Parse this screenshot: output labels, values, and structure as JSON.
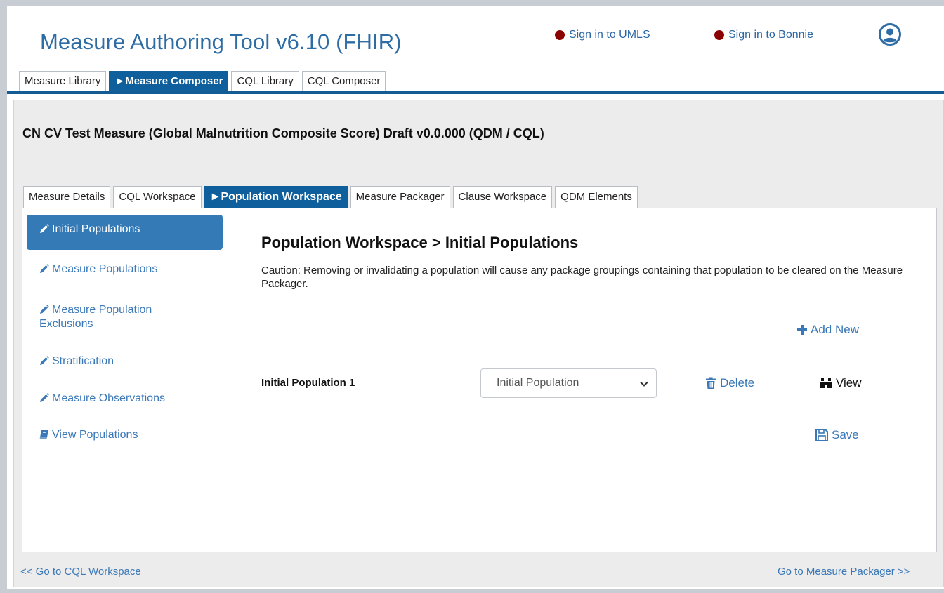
{
  "header": {
    "app_title": "Measure Authoring Tool v6.10 (FHIR)",
    "sign_in_umls": "Sign in to UMLS",
    "sign_in_bonnie": "Sign in to Bonnie",
    "status_color": "#8b0000"
  },
  "main_tabs": [
    {
      "label": "Measure Library",
      "active": false
    },
    {
      "label": "►Measure Composer",
      "active": true
    },
    {
      "label": "CQL Library",
      "active": false
    },
    {
      "label": "CQL Composer",
      "active": false
    }
  ],
  "measure": {
    "title": "CN CV Test Measure (Global Malnutrition Composite Score) Draft v0.0.000 (QDM / CQL)"
  },
  "sub_tabs": [
    {
      "label": "Measure Details",
      "active": false
    },
    {
      "label": "CQL Workspace",
      "active": false
    },
    {
      "label": "►Population Workspace",
      "active": true
    },
    {
      "label": "Measure Packager",
      "active": false
    },
    {
      "label": "Clause Workspace",
      "active": false
    },
    {
      "label": "QDM Elements",
      "active": false
    }
  ],
  "sidebar": {
    "items": [
      {
        "label": "Initial Populations",
        "icon": "pencil-icon",
        "active": true
      },
      {
        "label": "Measure Populations",
        "icon": "pencil-icon",
        "active": false
      },
      {
        "label": "Measure Population Exclusions",
        "icon": "pencil-icon",
        "active": false
      },
      {
        "label": "Stratification",
        "icon": "pencil-icon",
        "active": false
      },
      {
        "label": "Measure Observations",
        "icon": "pencil-icon",
        "active": false
      },
      {
        "label": "View Populations",
        "icon": "book-icon",
        "active": false
      }
    ]
  },
  "main": {
    "heading": "Population Workspace > Initial Populations",
    "caution": "Caution: Removing or invalidating a population will cause any package groupings containing that population to be cleared on the Measure Packager.",
    "add_new": "Add New",
    "population_label": "Initial Population 1",
    "population_select_value": "Initial Population",
    "delete": "Delete",
    "view": "View",
    "save": "Save"
  },
  "footer": {
    "prev": "<< Go to CQL Workspace",
    "next": "Go to Measure Packager >>"
  },
  "colors": {
    "brand_blue": "#2d6ca4",
    "active_tab": "#0e5f9c",
    "link_blue": "#3a78b7",
    "panel_bg": "#ececec"
  }
}
